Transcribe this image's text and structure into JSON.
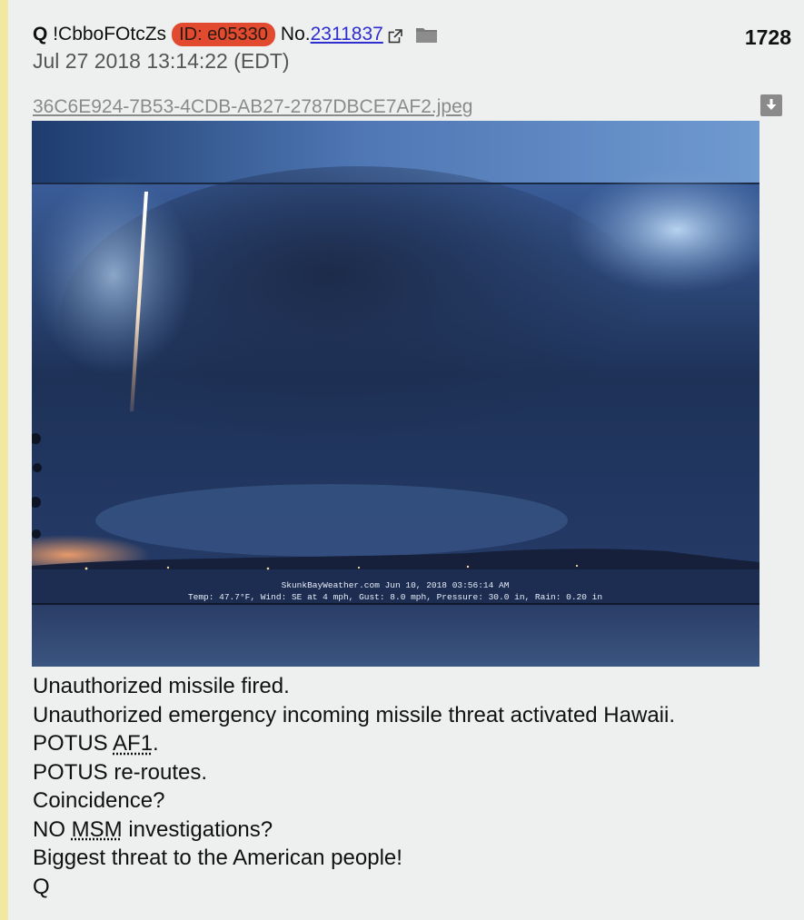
{
  "post": {
    "author": "Q",
    "tripcode": "!CbboFOtcZs",
    "id_badge": "ID: e05330",
    "number_prefix": "No.",
    "number": "2311837",
    "count": "1728",
    "date": "Jul 27 2018 13:14:22 (EDT)",
    "file_name": "36C6E924-7B53-4CDB-AB27-2787DBCE7AF2.jpeg",
    "image": {
      "overlay_line1": "SkunkBayWeather.com  Jun 10, 2018  03:56:14 AM",
      "overlay_line2": "Temp:  47.7°F, Wind: SE  at    4 mph, Gust:  8.0 mph, Pressure:  30.0 in, Rain: 0.20 in"
    },
    "body": {
      "line1": "Unauthorized missile fired.",
      "line2": "Unauthorized emergency incoming missile threat activated Hawaii.",
      "line3_prefix": "POTUS ",
      "line3_abbr": "AF1",
      "line3_suffix": ".",
      "line4": "POTUS re-routes.",
      "line5": "Coincidence?",
      "line6_prefix": "NO ",
      "line6_abbr": "MSM",
      "line6_suffix": " investigations?",
      "line7": "Biggest threat to the American people!",
      "line8": "Q"
    }
  },
  "icons": {
    "external": "external-link-icon",
    "folder": "folder-icon",
    "download": "download-icon"
  },
  "colors": {
    "post_background": "#eef0f0",
    "accent_bar": "#f1e9a0",
    "id_badge": "#e24a2f",
    "link": "#2d2dd0",
    "file_link": "#8a8a8a"
  }
}
